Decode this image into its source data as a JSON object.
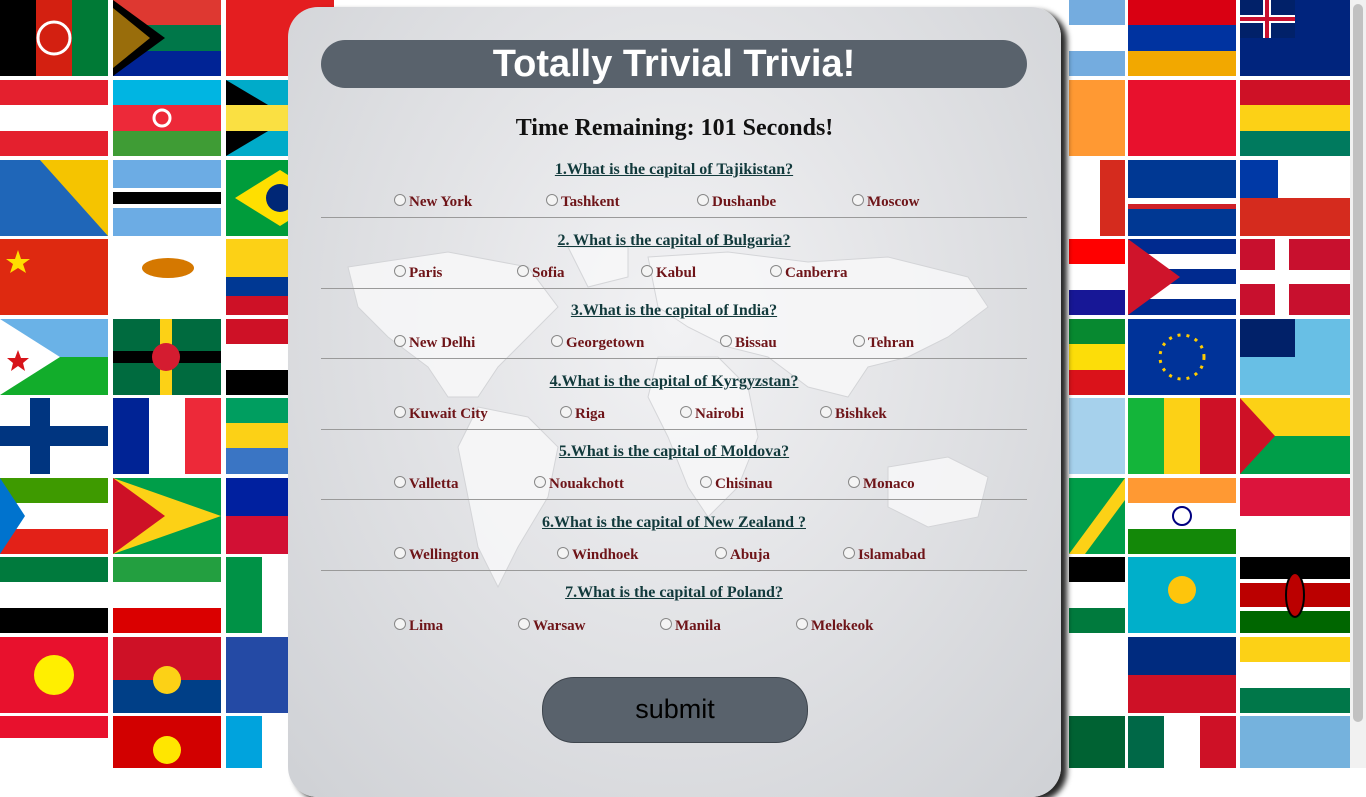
{
  "title": "Totally Trivial Trivia!",
  "timer_text": "Time Remaining: 101 Seconds!",
  "questions": [
    {
      "text": "1.What is the capital of Tajikistan?",
      "options": [
        "New York",
        "Tashkent",
        "Dushanbe",
        "Moscow"
      ]
    },
    {
      "text": "2. What is the capital of Bulgaria?",
      "options": [
        "Paris",
        "Sofia",
        "Kabul",
        "Canberra"
      ]
    },
    {
      "text": "3.What is the capital of India?",
      "options": [
        "New Delhi",
        "Georgetown",
        "Bissau",
        "Tehran"
      ]
    },
    {
      "text": "4.What is the capital of Kyrgyzstan?",
      "options": [
        "Kuwait City",
        "Riga",
        "Nairobi",
        "Bishkek"
      ]
    },
    {
      "text": "5.What is the capital of Moldova?",
      "options": [
        "Valletta",
        "Nouakchott",
        "Chisinau",
        "Monaco"
      ]
    },
    {
      "text": "6.What is the capital of New Zealand ?",
      "options": [
        "Wellington",
        "Windhoek",
        "Abuja",
        "Islamabad"
      ]
    },
    {
      "text": "7.What is the capital of Poland?",
      "options": [
        "Lima",
        "Warsaw",
        "Manila",
        "Melekeok"
      ]
    }
  ],
  "submit_label": "submit",
  "colors": {
    "title_bar": "#59626c",
    "question_text": "#123a3c",
    "option_text": "#6e1418"
  }
}
